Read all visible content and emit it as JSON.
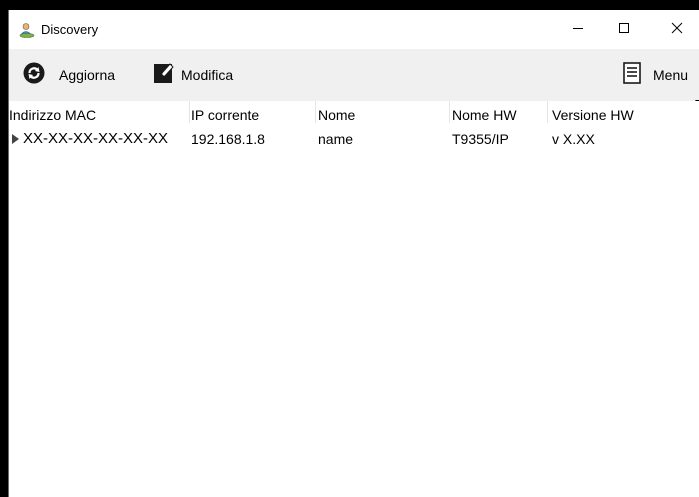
{
  "window": {
    "title": "Discovery",
    "controls": {
      "minimize_icon": "minimize-icon",
      "maximize_icon": "maximize-icon",
      "close_icon": "close-icon"
    }
  },
  "toolbar": {
    "refresh_label": "Aggiorna",
    "edit_label": "Modifica",
    "menu_label": "Menu"
  },
  "table": {
    "columns": [
      "Indirizzo MAC",
      "IP corrente",
      "Nome",
      "Nome HW",
      "Versione HW"
    ],
    "rows": [
      {
        "mac": "XX-XX-XX-XX-XX-XX",
        "ip": "192.168.1.8",
        "name": "name",
        "hw_name": "T9355/IP",
        "hw_version": "v X.XX"
      }
    ]
  },
  "colors": {
    "toolbar_bg": "#f0f0f0",
    "window_bg": "#ffffff",
    "frame": "#000000"
  }
}
